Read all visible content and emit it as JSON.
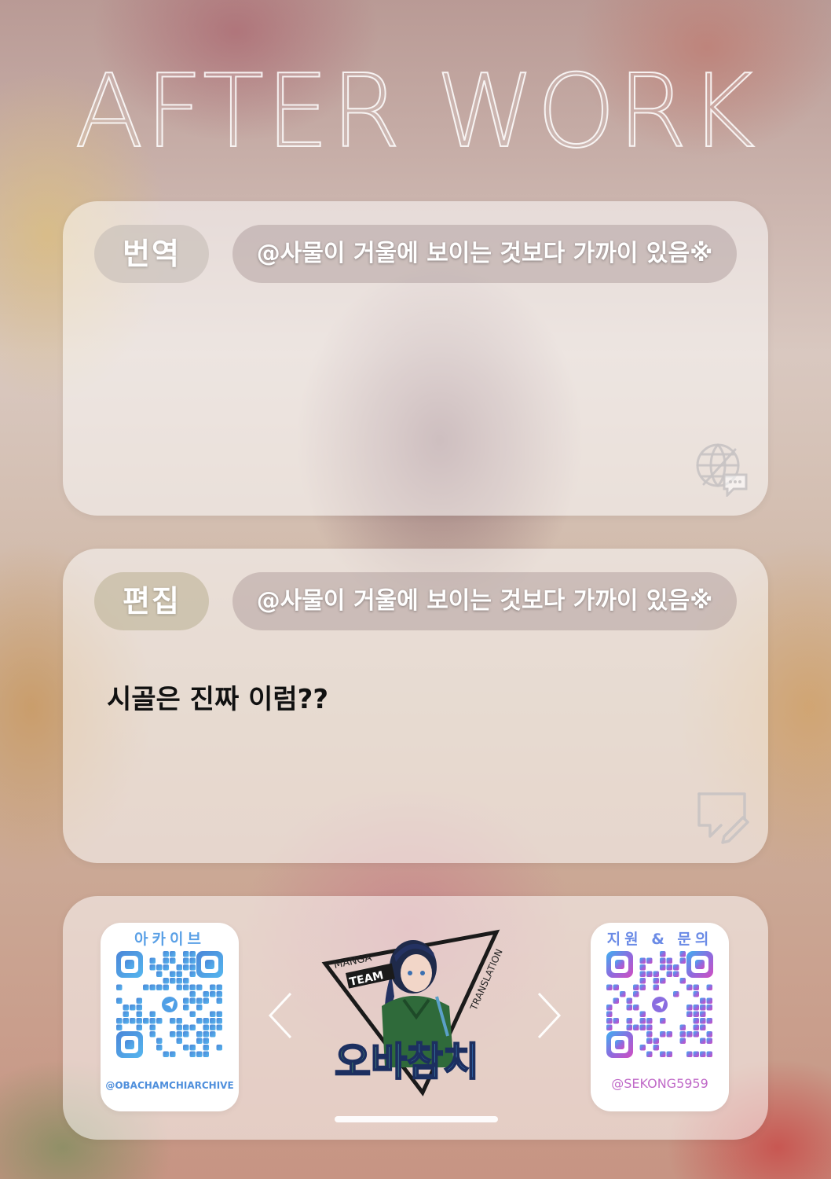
{
  "header": {
    "title": "AFTER WORK"
  },
  "translation": {
    "role_label": "번역",
    "credit": "@사물이 거울에 보이는 것보다 가까이 있음※"
  },
  "edit": {
    "role_label": "편집",
    "credit": "@사물이 거울에 보이는 것보다 가까이 있음※",
    "text": "시골은 진짜 이럼??"
  },
  "footer": {
    "archive": {
      "label": "아카이브",
      "handle": "@OBACHAMCHIARCHIVE"
    },
    "contact": {
      "label": "지원 & 문의",
      "handle": "@SEKONG5959"
    },
    "logo": {
      "name": "오바참치",
      "text_manga": "MANGA",
      "text_team": "TEAM",
      "text_translation": "TRANSLATION"
    }
  },
  "colors": {
    "archive_accent": "#5aa0e6",
    "contact_gradient_start": "#4aa8ee",
    "contact_gradient_end": "#c050c8",
    "logo_green": "#4fae5a",
    "logo_blue": "#3a7fd0"
  },
  "icons": {
    "translation_corner": "globe-speech-icon",
    "edit_corner": "speech-pencil-icon",
    "qr_center": "telegram-icon",
    "nav_prev": "chevron-left-icon",
    "nav_next": "chevron-right-icon"
  }
}
